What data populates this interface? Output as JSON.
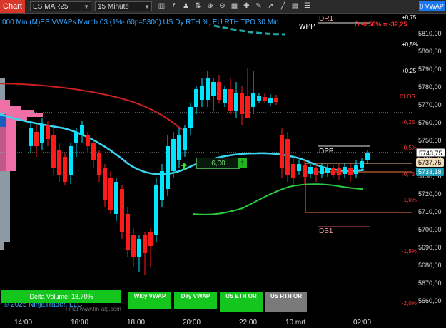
{
  "toolbar": {
    "chart_tab": "Chart",
    "instrument": "ES MAR25",
    "timeframe": "15 Minute",
    "vwap_button": "0 VWAP"
  },
  "chart": {
    "header": "000 Min (M)ES VWAPs March 03 (1%- 60p=5300)  US Dy RTH %, EU RTH TPO 30 Min",
    "delta_text": "D -0,56% = -32,25",
    "price_axis": [
      "5810,00",
      "5800,00",
      "5790,00",
      "5780,00",
      "5770,00",
      "5760,00",
      "5750,00",
      "5740,00",
      "5730,00",
      "5720,00",
      "5710,00",
      "5700,00",
      "5690,00",
      "5680,00",
      "5670,00",
      "5660,00"
    ],
    "pct_labels": [
      "+0,75",
      "+0,5%",
      "+0,25",
      "CLOS",
      "-0,25",
      "-0,5%",
      "-0,75",
      "-1,0%",
      "-1,5%",
      "-2,0%"
    ],
    "current_price": "5743,75",
    "price_tag_2": "5737,75",
    "price_tag_3": "5733,18",
    "box_value": "6,00",
    "box_badge": "1",
    "level_labels": {
      "dr1": "DR1",
      "wpp": "WPP",
      "dpp": "DPP",
      "ds1": "DS1"
    },
    "time_labels": [
      "14:00",
      "16:00",
      "18:00",
      "20:00",
      "22:00",
      "10 mrt",
      "02:00"
    ],
    "copyright": "© 2025 NinjaTrader, LLC",
    "watermark": "Final    www.fin-alg.com",
    "bottom_buttons": {
      "delta_volume": "Delta Volume: 18,70%",
      "wkly_vwap": "Wkly VWAP",
      "day_vwap": "Day VWAP",
      "us_eth_or": "US ETH OR",
      "us_rth_or": "US RTH OR"
    },
    "colors": {
      "up": "#00e5ff",
      "down": "#ff1a1a",
      "vwap_cyan": "#39d7f0",
      "vwap_red": "#cc1f1f",
      "vwap_green": "#29c940",
      "button_green": "#13c51c",
      "profile_pink": "#f06fa7",
      "profile_gray": "#8e9aa3"
    }
  }
}
